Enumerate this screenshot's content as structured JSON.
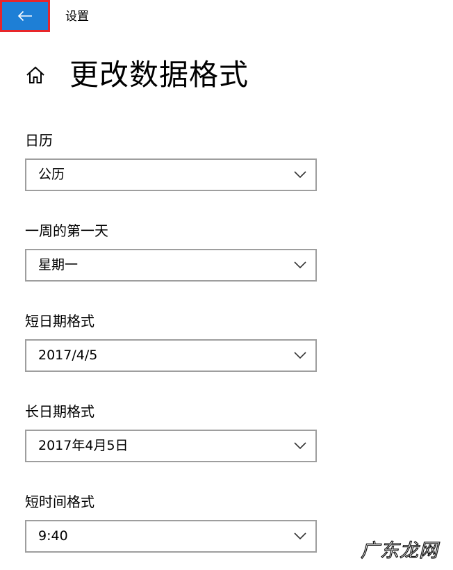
{
  "window": {
    "title": "设置"
  },
  "header": {
    "title": "更改数据格式"
  },
  "settings": [
    {
      "label": "日历",
      "value": "公历"
    },
    {
      "label": "一周的第一天",
      "value": "星期一"
    },
    {
      "label": "短日期格式",
      "value": "2017/4/5"
    },
    {
      "label": "长日期格式",
      "value": "2017年4月5日"
    },
    {
      "label": "短时间格式",
      "value": "9:40"
    }
  ],
  "watermark": "广东龙网",
  "colors": {
    "back_button_bg": "#1e7fd6",
    "highlight_border": "#e8262a",
    "select_border": "#9e9e9e"
  },
  "icons": {
    "back": "arrow-left-icon",
    "home": "home-icon",
    "dropdown": "chevron-down-icon"
  }
}
